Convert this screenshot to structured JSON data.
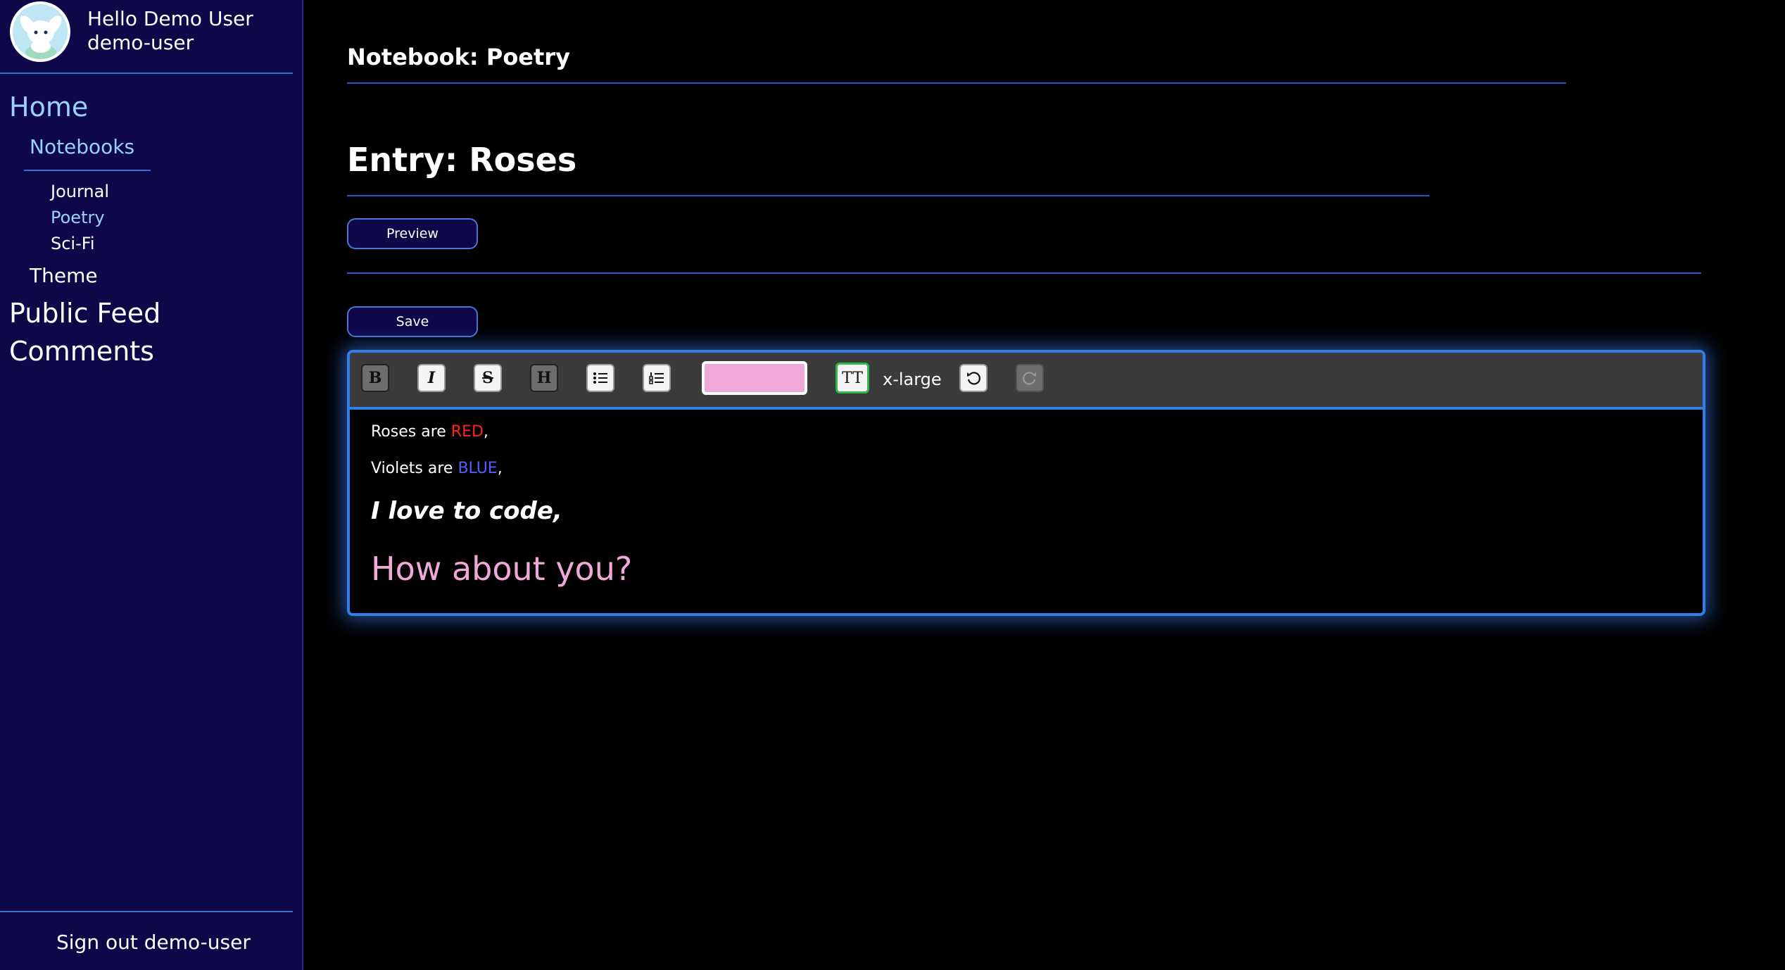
{
  "user": {
    "greeting": "Hello Demo User",
    "username": "demo-user"
  },
  "nav": {
    "home": "Home",
    "notebooks": "Notebooks",
    "notebook_items": [
      "Journal",
      "Poetry",
      "Sci-Fi"
    ],
    "theme": "Theme",
    "public_feed": "Public Feed",
    "comments": "Comments",
    "sign_out": "Sign out demo-user"
  },
  "page": {
    "notebook_title": "Notebook: Poetry",
    "entry_title": "Entry: Roses",
    "preview_label": "Preview",
    "save_label": "Save"
  },
  "toolbar": {
    "bold": "B",
    "italic": "I",
    "strike": "S",
    "heading": "H",
    "font_size_button": "TT",
    "font_size_value": "x-large",
    "text_color": "#f0a8d8",
    "icons": [
      "bold-icon",
      "italic-icon",
      "strikethrough-icon",
      "heading-icon",
      "bullet-list-icon",
      "numbered-list-icon",
      "text-size-icon",
      "undo-icon",
      "redo-icon"
    ]
  },
  "content": {
    "line1_prefix": "Roses are ",
    "line1_highlight": "RED",
    "line1_suffix": ",",
    "line2_prefix": "Violets are ",
    "line2_highlight": "BLUE",
    "line2_suffix": ",",
    "line3": "I love to code,",
    "line4": "How about you?"
  },
  "colors": {
    "sidebar_bg": "#0e0848",
    "accent_blue": "#2f7fe8",
    "link_blue": "#9ad0ff",
    "red": "#ff2020",
    "blue": "#5060ff",
    "pink": "#f0a8d8"
  }
}
